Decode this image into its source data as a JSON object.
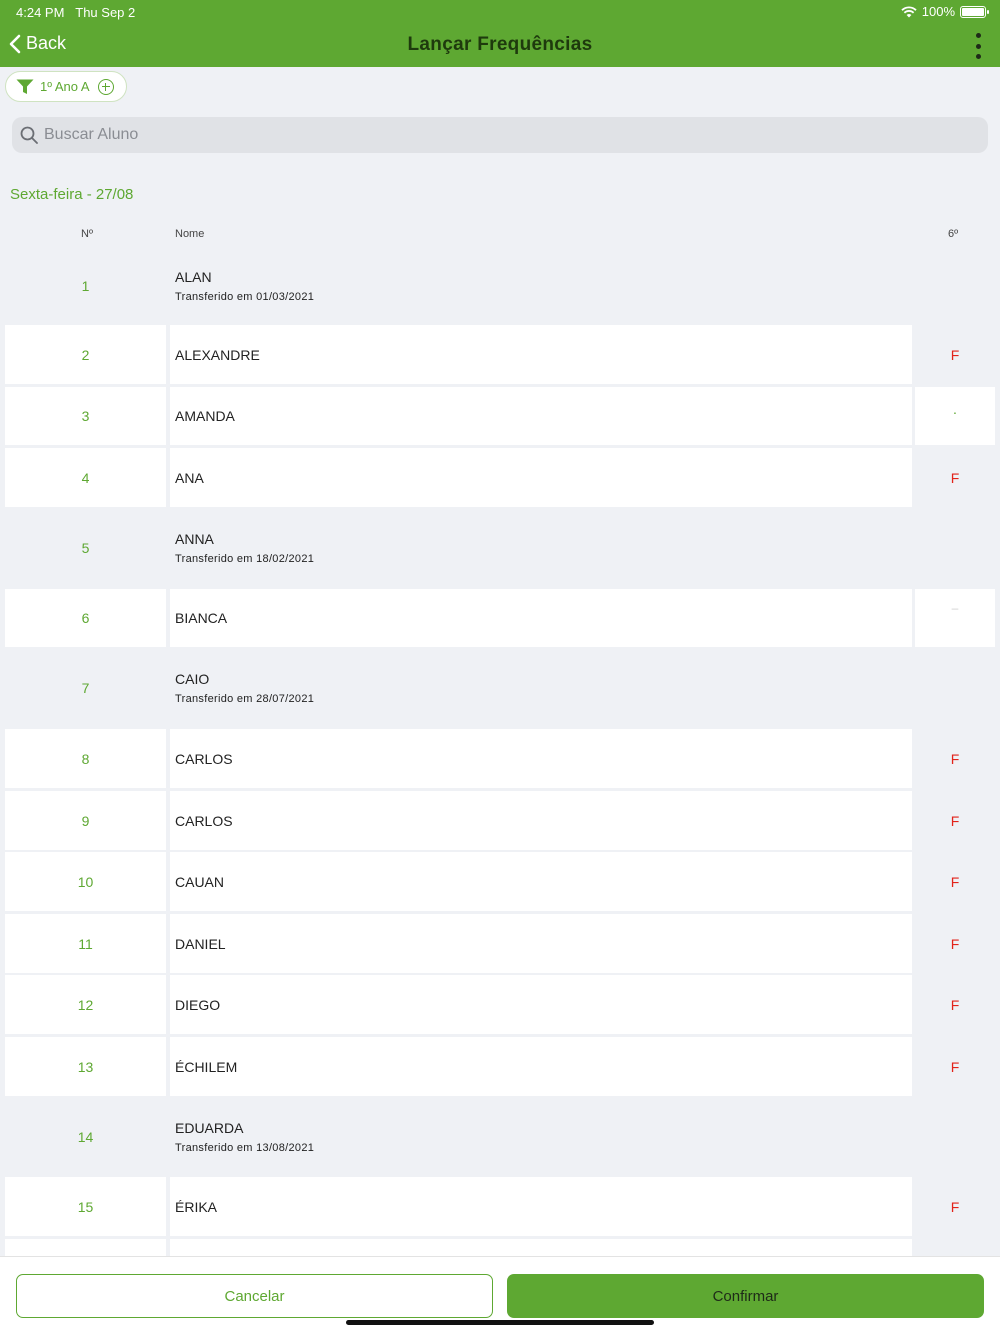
{
  "status_bar": {
    "time": "4:24 PM",
    "date": "Thu Sep 2",
    "battery": "100%"
  },
  "nav": {
    "back_label": "Back",
    "title": "Lançar Frequências"
  },
  "filter": {
    "label": "1º Ano A"
  },
  "search": {
    "placeholder": "Buscar Aluno"
  },
  "day_label": "Sexta-feira - 27/08",
  "columns": {
    "num": "Nº",
    "name": "Nome",
    "period": "6º"
  },
  "students": [
    {
      "num": "1",
      "name": "ALAN",
      "sub": "Transferido em 01/03/2021",
      "mark": ""
    },
    {
      "num": "2",
      "name": "ALEXANDRE",
      "sub": "",
      "mark": "F"
    },
    {
      "num": "3",
      "name": "AMANDA",
      "sub": "",
      "mark": "·"
    },
    {
      "num": "4",
      "name": "ANA",
      "sub": "",
      "mark": "F"
    },
    {
      "num": "5",
      "name": "ANNA",
      "sub": "Transferido em 18/02/2021",
      "mark": ""
    },
    {
      "num": "6",
      "name": "BIANCA",
      "sub": "",
      "mark": "–"
    },
    {
      "num": "7",
      "name": "CAIO",
      "sub": "Transferido em 28/07/2021",
      "mark": ""
    },
    {
      "num": "8",
      "name": "CARLOS",
      "sub": "",
      "mark": "F"
    },
    {
      "num": "9",
      "name": "CARLOS",
      "sub": "",
      "mark": "F"
    },
    {
      "num": "10",
      "name": "CAUAN",
      "sub": "",
      "mark": "F"
    },
    {
      "num": "11",
      "name": "DANIEL",
      "sub": "",
      "mark": "F"
    },
    {
      "num": "12",
      "name": "DIEGO",
      "sub": "",
      "mark": "F"
    },
    {
      "num": "13",
      "name": "ÉCHILEM",
      "sub": "",
      "mark": "F"
    },
    {
      "num": "14",
      "name": "EDUARDA",
      "sub": "Transferido em 13/08/2021",
      "mark": ""
    },
    {
      "num": "15",
      "name": "ÉRIKA",
      "sub": "",
      "mark": "F"
    }
  ],
  "footer": {
    "cancel_label": "Cancelar",
    "confirm_label": "Confirmar"
  },
  "colors": {
    "brand_green": "#5ea832",
    "absent_red": "#e2231a",
    "background": "#eff1f5"
  }
}
